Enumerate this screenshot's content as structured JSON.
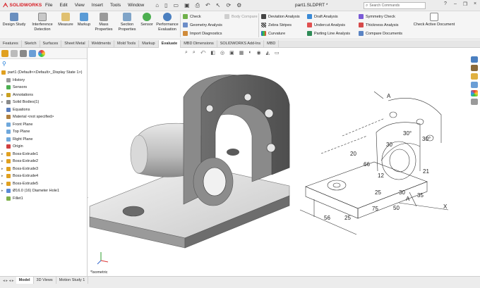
{
  "app": {
    "brand": "SOLIDWORKS",
    "document_title": "part1.SLDPRT *"
  },
  "menu": [
    "File",
    "Edit",
    "View",
    "Insert",
    "Tools",
    "Window"
  ],
  "search": {
    "placeholder": "Search Commands"
  },
  "ribbon": {
    "large": [
      {
        "label": "Design Study",
        "icon": "design-study-icon"
      },
      {
        "label": "Interference Detection",
        "icon": "interference-icon"
      },
      {
        "label": "Measure",
        "icon": "measure-icon"
      },
      {
        "label": "Markup",
        "icon": "markup-icon"
      },
      {
        "label": "Mass Properties",
        "icon": "mass-properties-icon"
      },
      {
        "label": "Section Properties",
        "icon": "section-properties-icon"
      },
      {
        "label": "Sensor",
        "icon": "sensor-icon"
      },
      {
        "label": "Performance Evaluation",
        "icon": "performance-icon"
      }
    ],
    "col1": [
      "Check",
      "Geometry Analysis",
      "Import Diagnostics"
    ],
    "col1b": [
      "Body Compare"
    ],
    "col2": [
      "Deviation Analysis",
      "Zebra Stripes",
      "Curvature"
    ],
    "col3": [
      "Draft Analysis",
      "Undercut Analysis",
      "Parting Line Analysis"
    ],
    "col4": [
      "Symmetry Check",
      "Thickness Analysis",
      "Compare Documents"
    ],
    "check_active": "Check Active Document"
  },
  "tabs": [
    "Features",
    "Sketch",
    "Surfaces",
    "Sheet Metal",
    "Weldments",
    "Mold Tools",
    "Markup",
    "Evaluate",
    "MBD Dimensions",
    "SOLIDWORKS Add-Ins",
    "MBD"
  ],
  "active_tab": "Evaluate",
  "tree": {
    "root": "part1  (Default<<Default>_Display State 1>)",
    "items": [
      {
        "label": "History",
        "expandable": false,
        "icon": "history-icon"
      },
      {
        "label": "Sensors",
        "expandable": false,
        "icon": "sensor-icon"
      },
      {
        "label": "Annotations",
        "expandable": true,
        "icon": "annotation-icon"
      },
      {
        "label": "Solid Bodies(1)",
        "expandable": true,
        "icon": "solid-bodies-icon"
      },
      {
        "label": "Equations",
        "expandable": false,
        "icon": "equations-icon"
      },
      {
        "label": "Material <not specified>",
        "expandable": false,
        "icon": "material-icon"
      },
      {
        "label": "Front Plane",
        "expandable": false,
        "icon": "plane-icon"
      },
      {
        "label": "Top Plane",
        "expandable": false,
        "icon": "plane-icon"
      },
      {
        "label": "Right Plane",
        "expandable": false,
        "icon": "plane-icon"
      },
      {
        "label": "Origin",
        "expandable": false,
        "icon": "origin-icon"
      },
      {
        "label": "Boss-Extrude1",
        "expandable": true,
        "icon": "extrude-icon"
      },
      {
        "label": "Boss-Extrude2",
        "expandable": true,
        "icon": "extrude-icon"
      },
      {
        "label": "Boss-Extrude3",
        "expandable": true,
        "icon": "extrude-icon"
      },
      {
        "label": "Boss-Extrude4",
        "expandable": true,
        "icon": "extrude-icon"
      },
      {
        "label": "Boss-Extrude5",
        "expandable": true,
        "icon": "extrude-icon"
      },
      {
        "label": "Ø16.0 (16) Diameter Hole1",
        "expandable": true,
        "icon": "hole-icon"
      },
      {
        "label": "Fillet1",
        "expandable": false,
        "icon": "fillet-icon"
      }
    ]
  },
  "viewport": {
    "view_label": "*Isometric"
  },
  "drawing": {
    "dims": [
      "30",
      "30",
      "12",
      "66",
      "20",
      "25",
      "50",
      "25",
      "21",
      "35",
      "75",
      "56",
      "A",
      "A",
      "X"
    ],
    "angles": [
      "30°",
      "30°"
    ]
  },
  "bottom_tabs": [
    "Model",
    "3D Views",
    "Motion Study 1"
  ],
  "active_bottom_tab": "Model",
  "colors": {
    "brand": "#d71920",
    "accent": "#1a7ad9"
  }
}
